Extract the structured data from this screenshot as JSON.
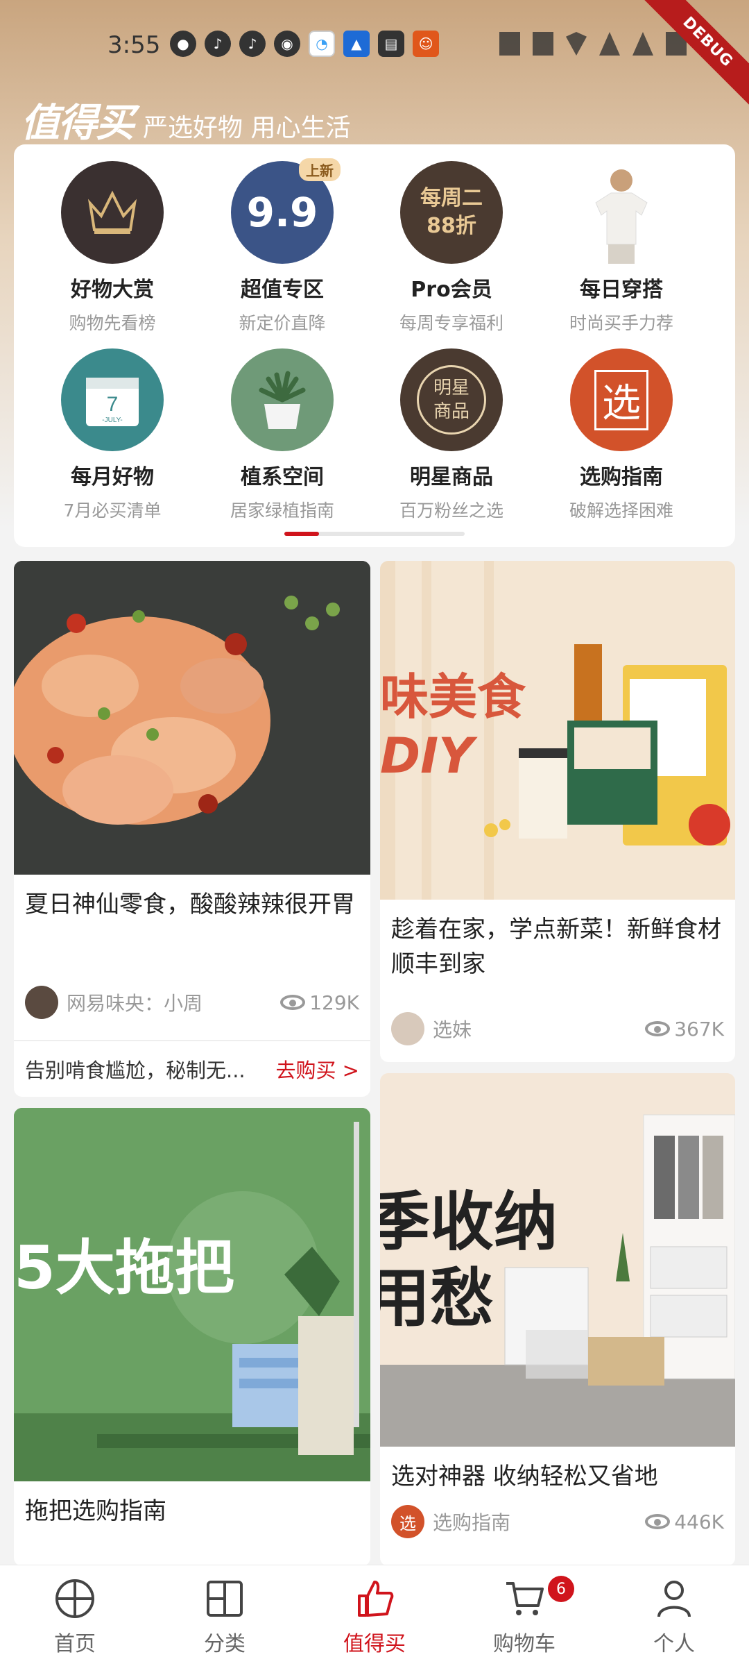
{
  "status_bar": {
    "time": "3:55",
    "debug_label": "DEBUG"
  },
  "header": {
    "brand_logo": "值得买",
    "slogan": "严选好物 用心生活"
  },
  "categories": [
    {
      "name": "好物大赏",
      "sub": "购物先看榜",
      "icon": "crown-icon",
      "color": "#3a3030"
    },
    {
      "name": "超值专区",
      "sub": "新定价直降",
      "icon": "price-99-icon",
      "color": "#3b5487",
      "badge": "上新",
      "glyph": "9.9"
    },
    {
      "name": "Pro会员",
      "sub": "每周专享福利",
      "icon": "pro-member-icon",
      "color": "#4a3a30",
      "glyph": "每周二\n88折"
    },
    {
      "name": "每日穿搭",
      "sub": "时尚买手力荐",
      "icon": "outfit-icon",
      "color": "#e6e0d8"
    },
    {
      "name": "每月好物",
      "sub": "7月必买清单",
      "icon": "calendar-icon",
      "color": "#3b8a8c",
      "glyph": "7\n-JULY-"
    },
    {
      "name": "植系空间",
      "sub": "居家绿植指南",
      "icon": "plant-icon",
      "color": "#6f9a78"
    },
    {
      "name": "明星商品",
      "sub": "百万粉丝之选",
      "icon": "star-product-icon",
      "color": "#4a3a30",
      "glyph": "明星\n商品"
    },
    {
      "name": "选购指南",
      "sub": "破解选择困难",
      "icon": "guide-icon",
      "color": "#d2522a",
      "glyph": "选"
    }
  ],
  "feed": {
    "card1": {
      "title": "夏日神仙零食，酸酸辣辣很开胃",
      "author": "网易味央：小周",
      "views": "129K",
      "promo_text": "告别啃食尴尬，秘制无...",
      "promo_link": "去购买 >"
    },
    "card2": {
      "title": "趁着在家，学点新菜！新鲜食材顺丰到家",
      "author": "选妹",
      "views": "367K",
      "banner_text": "味美食",
      "banner_text2": "DIY"
    },
    "card3": {
      "title": "拖把选购指南",
      "banner_text": "5大拖把"
    },
    "card4": {
      "title": "选对神器 收纳轻松又省地",
      "author": "选购指南",
      "views": "446K",
      "banner_text": "季收纳",
      "banner_text2": "用愁"
    }
  },
  "bottom_nav": [
    {
      "label": "首页",
      "icon": "home-icon"
    },
    {
      "label": "分类",
      "icon": "category-icon"
    },
    {
      "label": "值得买",
      "icon": "thumbs-up-icon",
      "active": true
    },
    {
      "label": "购物车",
      "icon": "cart-icon"
    },
    {
      "label": "个人",
      "icon": "person-icon"
    }
  ],
  "cart_count": "6",
  "colors": {
    "accent": "#d0141c",
    "header_gold": "#c9a57f"
  }
}
